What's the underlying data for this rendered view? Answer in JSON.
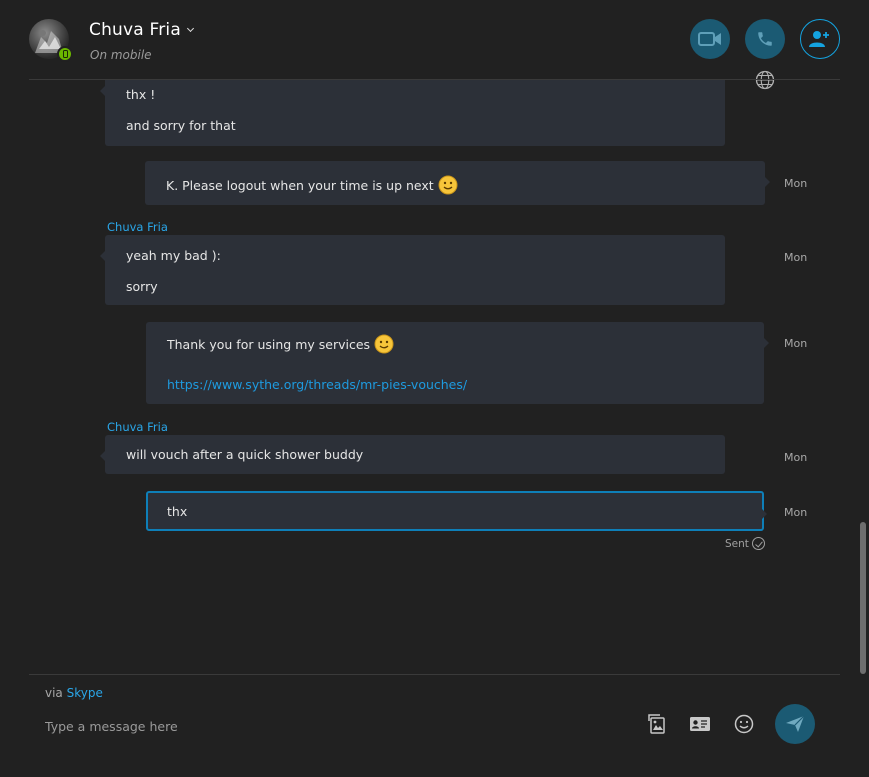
{
  "header": {
    "contact_name": "Chuva Fria",
    "status": "On mobile",
    "buttons": {
      "video_call": "video-icon",
      "audio_call": "phone-icon",
      "add_people": "add-person-icon",
      "translator": "globe-icon"
    }
  },
  "messages": [
    {
      "direction": "in",
      "lines": [
        "thx !",
        "and sorry for that"
      ],
      "time": ""
    },
    {
      "direction": "out",
      "lines": [
        "K. Please logout when your time is up next"
      ],
      "emoji": "smile",
      "time": "Mon"
    },
    {
      "direction": "in",
      "sender": "Chuva Fria",
      "lines": [
        "yeah my bad ):",
        "sorry"
      ],
      "time": "Mon"
    },
    {
      "direction": "out",
      "lines": [
        "Thank you for using my services"
      ],
      "emoji": "smile",
      "link": "https://www.sythe.org/threads/mr-pies-vouches/",
      "time": "Mon"
    },
    {
      "direction": "in",
      "sender": "Chuva Fria",
      "lines": [
        "will vouch after a quick shower buddy"
      ],
      "time": "Mon"
    },
    {
      "direction": "out",
      "lines": [
        "thx"
      ],
      "time": "Mon",
      "status": "Sent",
      "selected": true
    }
  ],
  "composer": {
    "via_prefix": "via",
    "via_service": "Skype",
    "placeholder": "Type a message here",
    "icons": [
      "media-icon",
      "contact-card-icon",
      "emoticon-icon",
      "send-icon"
    ]
  },
  "colors": {
    "background": "#212121",
    "bubble": "#2c3038",
    "accent": "#2aa6e8",
    "button": "#1b5a73",
    "presence": "#6bb700"
  }
}
